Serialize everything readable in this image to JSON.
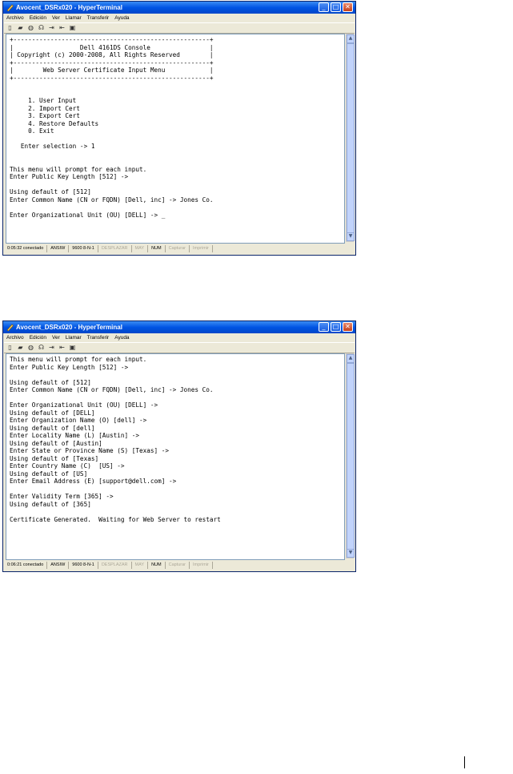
{
  "windows": [
    {
      "title": "Avocent_DSRx020 - HyperTerminal",
      "menu": [
        "Archivo",
        "Edición",
        "Ver",
        "Llamar",
        "Transferir",
        "Ayuda"
      ],
      "terminal_text": "+-----------------------------------------------------+\n|                  Dell 4161DS Console                |\n| Copyright (c) 2000-2008, All Rights Reserved        |\n+-----------------------------------------------------+\n|        Web Server Certificate Input Menu            |\n+-----------------------------------------------------+\n\n\n     1. User Input\n     2. Import Cert\n     3. Export Cert\n     4. Restore Defaults\n     0. Exit\n\n   Enter selection -> 1\n\n\nThis menu will prompt for each input.\nEnter Public Key Length [512] ->\n\nUsing default of [512]\nEnter Common Name (CN or FQDN) [Dell, inc] -> Jones Co.\n\nEnter Organizational Unit (OU) [DELL] -> _",
      "status": {
        "time": "0:05:32 conectado",
        "emulation": "ANSIW",
        "settings": "9600 8-N-1",
        "scroll": "DESPLAZAR",
        "caps": "MAY",
        "num": "NUM",
        "capture": "Capturar",
        "print": "Imprimir"
      }
    },
    {
      "title": "Avocent_DSRx020 - HyperTerminal",
      "menu": [
        "Archivo",
        "Edición",
        "Ver",
        "Llamar",
        "Transferir",
        "Ayuda"
      ],
      "terminal_text": "This menu will prompt for each input.\nEnter Public Key Length [512] ->\n\nUsing default of [512]\nEnter Common Name (CN or FQDN) [Dell, inc] -> Jones Co.\n\nEnter Organizational Unit (OU) [DELL] ->\nUsing default of [DELL]\nEnter Organization Name (O) [dell] ->\nUsing default of [dell]\nEnter Locality Name (L) [Austin] ->\nUsing default of [Austin]\nEnter State or Province Name (S) [Texas] ->\nUsing default of [Texas]\nEnter Country Name (C)  [US] ->\nUsing default of [US]\nEnter Email Address (E) [support@dell.com] ->\n\nEnter Validity Term [365] ->\nUsing default of [365]\n\nCertificate Generated.  Waiting for Web Server to restart",
      "status": {
        "time": "0:06:21 conectado",
        "emulation": "ANSIW",
        "settings": "9600 8-N-1",
        "scroll": "DESPLAZAR",
        "caps": "MAY",
        "num": "NUM",
        "capture": "Capturar",
        "print": "Imprimir"
      }
    }
  ]
}
